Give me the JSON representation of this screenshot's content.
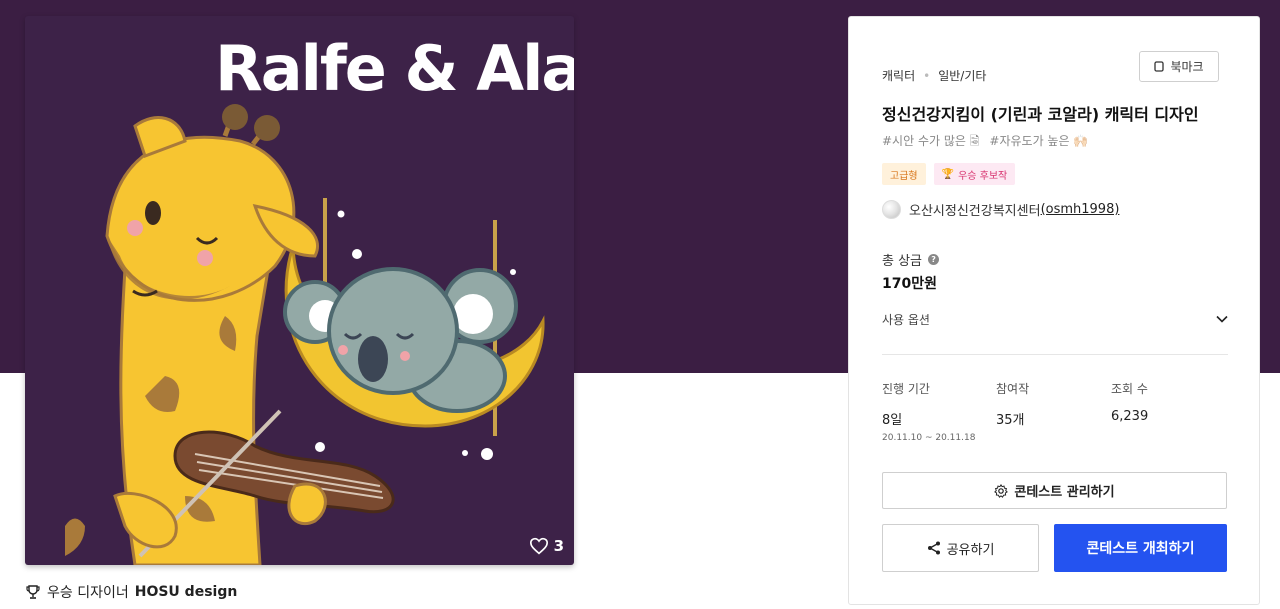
{
  "artwork": {
    "title_text": "Ralfe & Ala",
    "like_count": "3"
  },
  "winner_line": {
    "prefix": "우승 디자이너",
    "name": "HOSU design"
  },
  "contest": {
    "category": "캐릭터",
    "subcategory": "일반/기타",
    "bookmark_label": "북마크",
    "title": "정신건강지킴이 (기린과 코알라) 캐릭터 디자인",
    "tags": [
      "#시안 수가 많은 🗟",
      "#자유도가 높은 🙌🏻"
    ],
    "badges": {
      "premium": "고급형",
      "candidate": "우승 후보작"
    },
    "host_name": "오산시정신건강복지센터",
    "host_handle": "(osmh1998)",
    "prize_label": "총 상금",
    "prize_value": "170만원",
    "usage_options": "사용 옵션",
    "stats": {
      "period_label": "진행 기간",
      "period_value": "8일",
      "period_dates": "20.11.10 ~ 20.11.18",
      "entries_label": "참여작",
      "entries_value": "35개",
      "views_label": "조회 수",
      "views_value": "6,239"
    },
    "manage_label": "콘테스트 관리하기",
    "share_label": "공유하기",
    "host_contest_label": "콘테스트 개최하기"
  },
  "colors": {
    "hero_bg": "#3b1e43",
    "primary_button": "#2453f0",
    "giraffe": "#f7c531",
    "koala": "#93a9a6"
  }
}
